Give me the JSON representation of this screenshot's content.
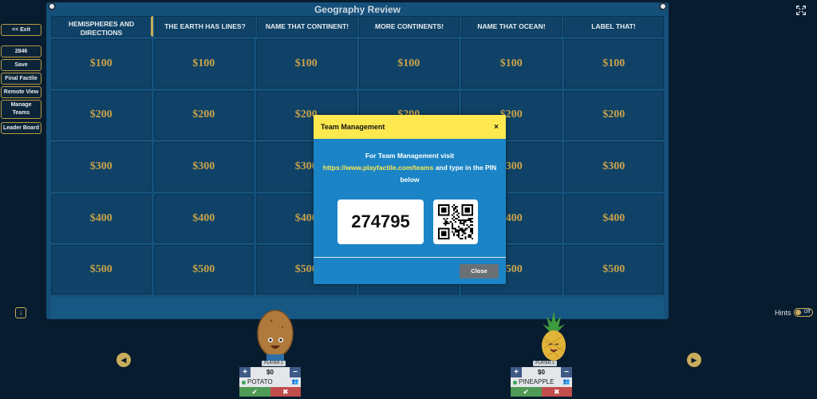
{
  "board": {
    "title": "Geography Review",
    "categories": [
      "HEMISPHERES AND DIRECTIONS",
      "THE EARTH HAS LINES?",
      "NAME THAT CONTINENT!",
      "MORE CONTINENTS!",
      "NAME THAT OCEAN!",
      "LABEL THAT!"
    ],
    "values": [
      "$100",
      "$200",
      "$300",
      "$400",
      "$500"
    ]
  },
  "controls": {
    "exit": "<< Exit",
    "game_id": "2846",
    "save": "Save",
    "final": "Final Factile",
    "remote": "Remote View",
    "manage": "Manage Teams",
    "leader": "Leader Board"
  },
  "hints": {
    "label": "Hints",
    "state": "Off"
  },
  "players": [
    {
      "tag": "PLAYER 2",
      "score": "$0",
      "name": "POTATO"
    },
    {
      "tag": "PLAYER 1",
      "score": "$0",
      "name": "PINEAPPLE"
    }
  ],
  "modal": {
    "title": "Team Management",
    "line1": "For Team Management visit",
    "link": "https://www.playfactile.com/teams",
    "line2": " and type in the PIN below",
    "pin": "274795",
    "close": "Close",
    "close_x": "×"
  },
  "colors": {
    "board": "#14507a",
    "gold": "#c9a24a",
    "modal_head": "#fde84f",
    "modal_body": "#1b84c6"
  }
}
